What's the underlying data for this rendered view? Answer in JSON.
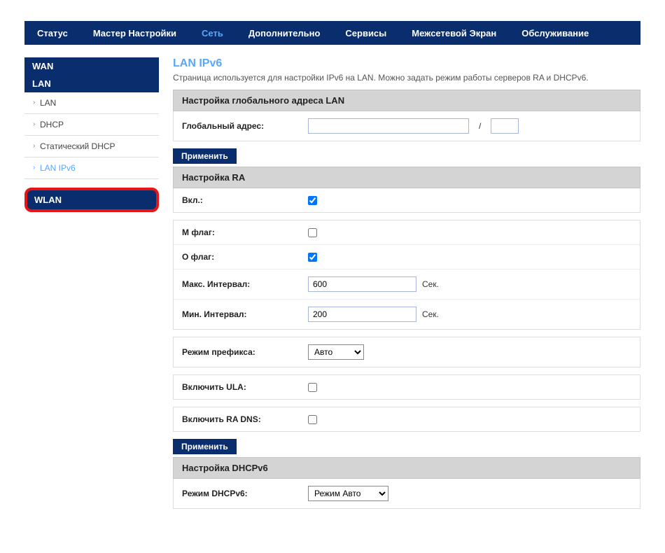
{
  "topnav": {
    "items": [
      {
        "label": "Статус"
      },
      {
        "label": "Мастер Настройки"
      },
      {
        "label": "Сеть",
        "active": true
      },
      {
        "label": "Дополнительно"
      },
      {
        "label": "Сервисы"
      },
      {
        "label": "Межсетевой Экран"
      },
      {
        "label": "Обслуживание"
      }
    ]
  },
  "sidebar": {
    "wan_header": "WAN",
    "lan_header": "LAN",
    "items": [
      {
        "label": "LAN"
      },
      {
        "label": "DHCP"
      },
      {
        "label": "Статический DHCP"
      },
      {
        "label": "LAN IPv6",
        "active": true
      }
    ],
    "wlan_header": "WLAN"
  },
  "main": {
    "title": "LAN IPv6",
    "desc": "Страница используется для настройки IPv6 на LAN. Можно задать режим работы серверов RA и DHCPv6.",
    "section_global": "Настройка глобального адреса LAN",
    "global_addr_label": "Глобальный адрес:",
    "global_addr_value": "",
    "global_prefix_value": "",
    "slash": "/",
    "apply1": "Применить",
    "section_ra": "Настройка RA",
    "ra_enable_label": "Вкл.:",
    "ra_enable_checked": true,
    "m_flag_label": "M флаг:",
    "m_flag_checked": false,
    "o_flag_label": "O флаг:",
    "o_flag_checked": true,
    "max_interval_label": "Макс. Интервал:",
    "max_interval_value": "600",
    "min_interval_label": "Мин. Интервал:",
    "min_interval_value": "200",
    "sec_unit": "Сек.",
    "prefix_mode_label": "Режим префикса:",
    "prefix_mode_value": "Авто",
    "ula_label": "Включить ULA:",
    "ula_checked": false,
    "ra_dns_label": "Включить RA DNS:",
    "ra_dns_checked": false,
    "apply2": "Применить",
    "section_dhcpv6": "Настройка DHCPv6",
    "dhcpv6_mode_label": "Режим DHCPv6:",
    "dhcpv6_mode_value": "Режим Авто"
  }
}
